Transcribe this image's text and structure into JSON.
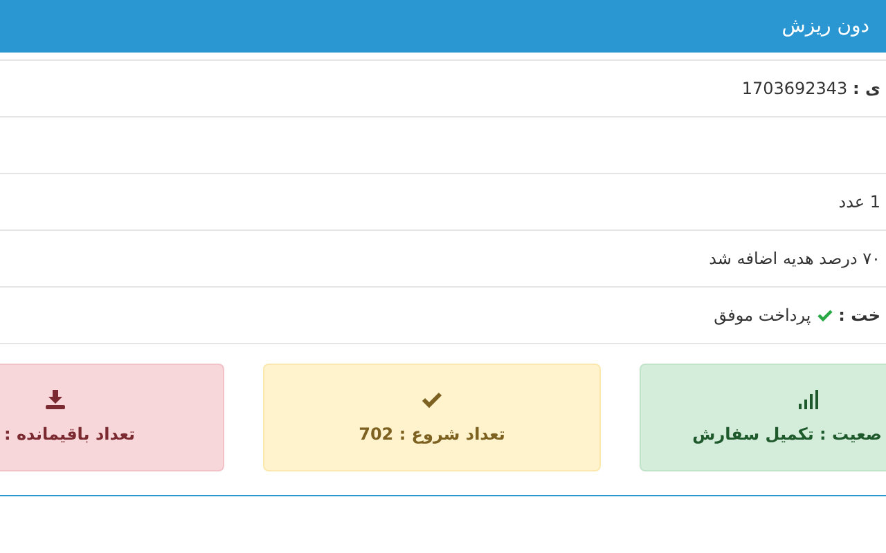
{
  "header": {
    "title": "دون ریزش"
  },
  "rows": [
    {
      "kind": "text",
      "text": "**ی :** 1703692343"
    },
    {
      "kind": "empty"
    },
    {
      "kind": "text",
      "text": "1 عدد"
    },
    {
      "kind": "text",
      "text": "۷۰ درصد هدیه اضافه شد"
    },
    {
      "kind": "status",
      "label": "خت :",
      "value": "پرداخت موفق"
    }
  ],
  "cards": [
    {
      "kind": "status",
      "text": "صعیت : تکمیل سفارش"
    },
    {
      "kind": "start",
      "text": "تعداد شروع : 702"
    },
    {
      "kind": "remaining",
      "text": "تعداد باقیمانده :"
    }
  ]
}
